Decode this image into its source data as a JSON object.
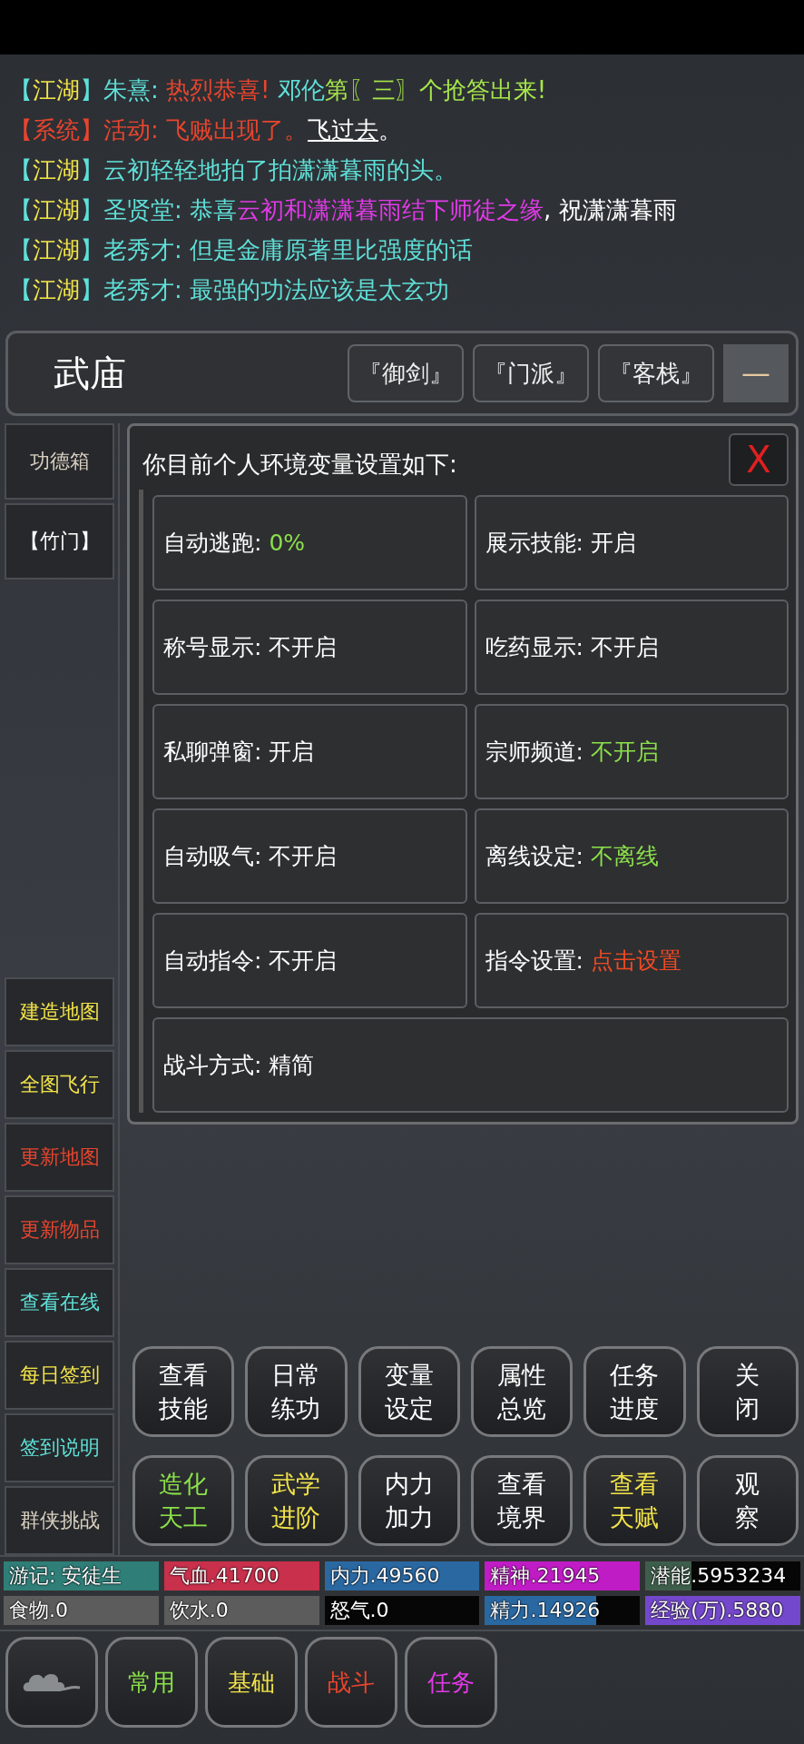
{
  "chat": [
    {
      "segments": [
        {
          "text": "【",
          "color": "#5fe0d8"
        },
        {
          "text": "江湖",
          "color": "#f2e34a"
        },
        {
          "text": "】朱熹: ",
          "color": "#5fe0d8"
        },
        {
          "text": "热烈恭喜! ",
          "color": "#e8452e"
        },
        {
          "text": "邓伦",
          "color": "#5fe0d8"
        },
        {
          "text": "第〖三〗个抢答出来!",
          "color": "#a6e64a"
        }
      ]
    },
    {
      "segments": [
        {
          "text": "【系统】活动: 飞贼出现了。",
          "color": "#e8452e"
        },
        {
          "text": "飞过去",
          "color": "#ffffff",
          "kind": "link"
        },
        {
          "text": "。"
        }
      ]
    },
    {
      "segments": [
        {
          "text": "【",
          "color": "#5fe0d8"
        },
        {
          "text": "江湖",
          "color": "#f2e34a"
        },
        {
          "text": "】云初轻轻地拍了拍潇潇暮雨的头。",
          "color": "#5fe0d8"
        }
      ]
    },
    {
      "segments": [
        {
          "text": "【",
          "color": "#5fe0d8"
        },
        {
          "text": "江湖",
          "color": "#f2e34a"
        },
        {
          "text": "】圣贤堂: 恭喜",
          "color": "#5fe0d8"
        },
        {
          "text": "云初和潇潇暮雨结下师徒之缘",
          "color": "#e03ae6"
        },
        {
          "text": ", 祝潇潇暮雨",
          "color": "#ffffff"
        }
      ]
    },
    {
      "segments": [
        {
          "text": "【",
          "color": "#5fe0d8"
        },
        {
          "text": "江湖",
          "color": "#f2e34a"
        },
        {
          "text": "】老秀才: 但是金庸原著里比强度的话",
          "color": "#5fe0d8"
        }
      ]
    },
    {
      "segments": [
        {
          "text": "【",
          "color": "#5fe0d8"
        },
        {
          "text": "江湖",
          "color": "#f2e34a"
        },
        {
          "text": "】老秀才: 最强的功法应该是太玄功",
          "color": "#5fe0d8"
        }
      ]
    }
  ],
  "header": {
    "title": "武庙",
    "links": [
      "『御剑』",
      "『门派』",
      "『客栈』"
    ],
    "collapse": "—"
  },
  "side_top": [
    {
      "label": "功德箱",
      "color": "#d8cfc0"
    },
    {
      "label": "【竹门】",
      "color": "#ffffff"
    }
  ],
  "side_bottom": [
    {
      "label": "建造地图",
      "color": "#f2e34a"
    },
    {
      "label": "全图飞行",
      "color": "#f2e34a"
    },
    {
      "label": "更新地图",
      "color": "#e8452e"
    },
    {
      "label": "更新物品",
      "color": "#e8452e"
    },
    {
      "label": "查看在线",
      "color": "#5fe0d8"
    },
    {
      "label": "每日签到",
      "color": "#f2e34a"
    },
    {
      "label": "签到说明",
      "color": "#5fe0d8"
    },
    {
      "label": "群侠挑战",
      "color": "#d8cfc0"
    }
  ],
  "dialog": {
    "title": "你目前个人环境变量设置如下:",
    "close": "X",
    "settings": [
      {
        "label": "自动逃跑: ",
        "value": "0%",
        "color": "#8be04a"
      },
      {
        "label": "展示技能: ",
        "value": "开启",
        "color": "#ffffff"
      },
      {
        "label": "称号显示: ",
        "value": "不开启",
        "color": "#ffffff"
      },
      {
        "label": "吃药显示: ",
        "value": "不开启",
        "color": "#ffffff"
      },
      {
        "label": "私聊弹窗: ",
        "value": " 开启",
        "color": "#ffffff"
      },
      {
        "label": "宗师频道: ",
        "value": "不开启",
        "color": "#8be04a"
      },
      {
        "label": "自动吸气: ",
        "value": "不开启",
        "color": "#ffffff"
      },
      {
        "label": "离线设定: ",
        "value": "不离线",
        "color": "#8be04a"
      },
      {
        "label": "自动指令: ",
        "value": "不开启",
        "color": "#ffffff"
      },
      {
        "label": "指令设置: ",
        "value": "点击设置",
        "color": "#f04a24"
      },
      {
        "label": "战斗方式: ",
        "value": "精简",
        "color": "#ffffff"
      }
    ]
  },
  "actions": [
    {
      "lines": [
        "查看",
        "技能"
      ],
      "color": "#ffffff"
    },
    {
      "lines": [
        "日常",
        "练功"
      ],
      "color": "#ffffff"
    },
    {
      "lines": [
        "变量",
        "设定"
      ],
      "color": "#ffffff"
    },
    {
      "lines": [
        "属性",
        "总览"
      ],
      "color": "#ffffff"
    },
    {
      "lines": [
        "任务",
        "进度"
      ],
      "color": "#ffffff"
    },
    {
      "lines": [
        "关",
        "闭"
      ],
      "color": "#ffffff"
    },
    {
      "lines": [
        "造化",
        "天工"
      ],
      "color": "#8be04a"
    },
    {
      "lines": [
        "武学",
        "进阶"
      ],
      "color": "#f2e34a"
    },
    {
      "lines": [
        "内力",
        "加力"
      ],
      "color": "#ffffff"
    },
    {
      "lines": [
        "查看",
        "境界"
      ],
      "color": "#ffffff"
    },
    {
      "lines": [
        "查看",
        "天赋"
      ],
      "color": "#f2e34a"
    },
    {
      "lines": [
        "观",
        "察"
      ],
      "color": "#ffffff"
    }
  ],
  "stats": [
    {
      "text": "游记: 安徒生",
      "color": "#2f7e78",
      "level": 1
    },
    {
      "text": "气血.41700",
      "color": "#c8304c",
      "level": 1
    },
    {
      "text": "内力.49560",
      "color": "#2a68a2",
      "level": 1
    },
    {
      "text": "精神.21945",
      "color": "#c01cc6",
      "level": 1
    },
    {
      "text": "潜能.5953234",
      "color": "#3e5e4c",
      "level": 0.3
    },
    {
      "text": "食物.0",
      "color": "#5c5c5c",
      "level": 1
    },
    {
      "text": "饮水.0",
      "color": "#5c5c5c",
      "level": 1
    },
    {
      "text": "怒气.0"
    },
    {
      "text": "精力.14926",
      "color": "#2a68a2",
      "level": 0.72
    },
    {
      "text": "经验(万).5880",
      "color": "#7448cc",
      "level": 1
    }
  ],
  "tabs": [
    {
      "label": "常用",
      "color": "#8be04a"
    },
    {
      "label": "基础",
      "color": "#f2e34a"
    },
    {
      "label": "战斗",
      "color": "#e8452e"
    },
    {
      "label": "任务",
      "color": "#e03ae6"
    }
  ]
}
